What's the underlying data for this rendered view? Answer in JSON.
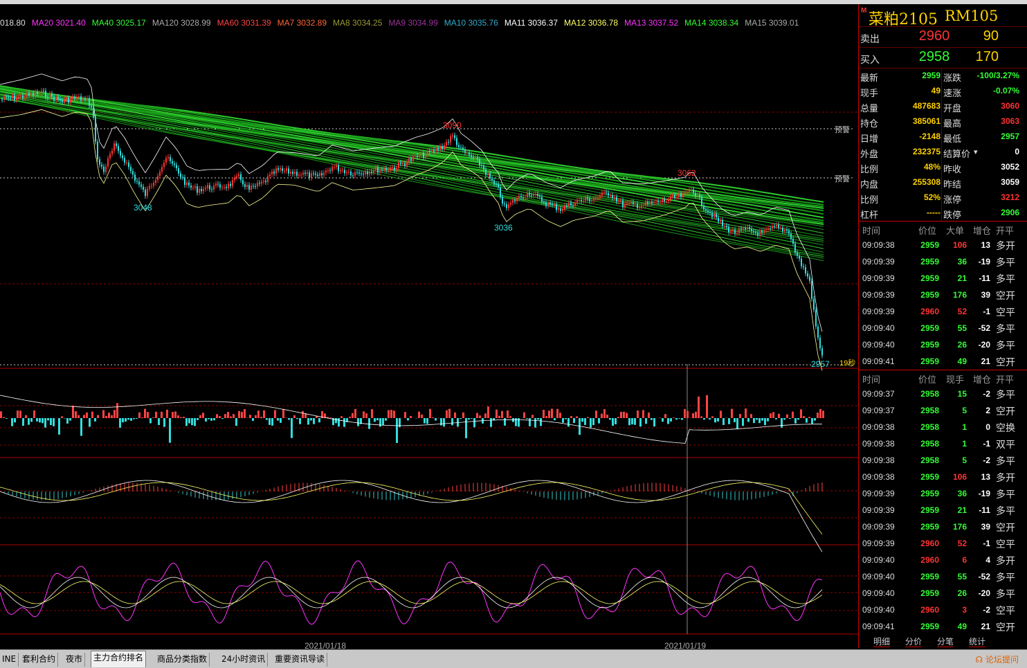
{
  "ma_legend": [
    {
      "text": "018.80",
      "color": "#dddddd"
    },
    {
      "text": "MA20 3021.40",
      "color": "#ff33ff"
    },
    {
      "text": "MA40 3025.17",
      "color": "#33ff33"
    },
    {
      "text": "MA120 3028.99",
      "color": "#aaaaaa"
    },
    {
      "text": "MA60 3031.39",
      "color": "#ff4444"
    },
    {
      "text": "MA7 3032.89",
      "color": "#ff6633"
    },
    {
      "text": "MA8 3034.25",
      "color": "#999933"
    },
    {
      "text": "MA9 3034.99",
      "color": "#993399"
    },
    {
      "text": "MA10 3035.76",
      "color": "#33aacc"
    },
    {
      "text": "MA11 3036.37",
      "color": "#ffffff"
    },
    {
      "text": "MA12 3036.78",
      "color": "#ffff66"
    },
    {
      "text": "MA13 3037.52",
      "color": "#ff33ff"
    },
    {
      "text": "MA14 3038.34",
      "color": "#33ff33"
    },
    {
      "text": "MA15 3039.01",
      "color": "#aaaaaa"
    }
  ],
  "chart": {
    "labels": {
      "high1": "3090",
      "low1": "3048",
      "low2": "3036",
      "high2": "3062",
      "last": "2957",
      "countdown": "19秒",
      "warn1": "预警",
      "warn2": "预警"
    },
    "dates": [
      "2021/01/18",
      "2021/01/19"
    ],
    "colors": {
      "up": "#ff3333",
      "down": "#33dddd",
      "ma_band": "#22bb22",
      "boll": "#ffffff",
      "grid": "#8b0000"
    }
  },
  "symbol": {
    "marker": "M",
    "name": "菜粕2105",
    "code": "RM105"
  },
  "bid_ask": [
    {
      "label": "卖出",
      "price": "2960",
      "volume": "90",
      "price_color": "#ff3333"
    },
    {
      "label": "买入",
      "price": "2958",
      "volume": "170",
      "price_color": "#33ff33"
    }
  ],
  "quote": [
    {
      "l1": "最新",
      "v1": "2959",
      "c1": "#33ff33",
      "l2": "涨跌",
      "v2": "-100/3.27%",
      "c2": "#33ff33"
    },
    {
      "l1": "现手",
      "v1": "49",
      "c1": "#ffd200",
      "l2": "速涨",
      "v2": "-0.07%",
      "c2": "#33ff33"
    },
    {
      "l1": "总量",
      "v1": "487683",
      "c1": "#ffd200",
      "l2": "开盘",
      "v2": "3060",
      "c2": "#ff3333"
    },
    {
      "l1": "持仓",
      "v1": "385061",
      "c1": "#ffd200",
      "l2": "最高",
      "v2": "3063",
      "c2": "#ff3333"
    },
    {
      "l1": "日增",
      "v1": "-2148",
      "c1": "#ffd200",
      "l2": "最低",
      "v2": "2957",
      "c2": "#33ff33"
    },
    {
      "l1": "外盘",
      "v1": "232375",
      "c1": "#ffd200",
      "l2": "结算价",
      "v2": "0",
      "c2": "#ffffff"
    },
    {
      "l1": "比例",
      "v1": "48%",
      "c1": "#ffd200",
      "l2": "昨收",
      "v2": "3052",
      "c2": "#ffffff"
    },
    {
      "l1": "内盘",
      "v1": "255308",
      "c1": "#ffd200",
      "l2": "昨结",
      "v2": "3059",
      "c2": "#ffffff"
    },
    {
      "l1": "比例",
      "v1": "52%",
      "c1": "#ffd200",
      "l2": "涨停",
      "v2": "3212",
      "c2": "#ff3333"
    },
    {
      "l1": "杠杆",
      "v1": "-----",
      "c1": "#ffd200",
      "l2": "跌停",
      "v2": "2906",
      "c2": "#33ff33"
    }
  ],
  "tick_header": {
    "time": "时间",
    "price": "价位",
    "big": "大单",
    "oi": "增仓",
    "type": "开平"
  },
  "ticks1": [
    {
      "time": "09:09:38",
      "price": "2959",
      "pc": "#33ff33",
      "big": "106",
      "bc": "#ff3333",
      "oi": "13",
      "type": "多开"
    },
    {
      "time": "09:09:39",
      "price": "2959",
      "pc": "#33ff33",
      "big": "36",
      "bc": "#33ff33",
      "oi": "-19",
      "type": "多平"
    },
    {
      "time": "09:09:39",
      "price": "2959",
      "pc": "#33ff33",
      "big": "21",
      "bc": "#33ff33",
      "oi": "-11",
      "type": "多平"
    },
    {
      "time": "09:09:39",
      "price": "2959",
      "pc": "#33ff33",
      "big": "176",
      "bc": "#33ff33",
      "oi": "39",
      "type": "空开"
    },
    {
      "time": "09:09:39",
      "price": "2960",
      "pc": "#ff3333",
      "big": "52",
      "bc": "#ff3333",
      "oi": "-1",
      "type": "空平"
    },
    {
      "time": "09:09:40",
      "price": "2959",
      "pc": "#33ff33",
      "big": "55",
      "bc": "#33ff33",
      "oi": "-52",
      "type": "多平"
    },
    {
      "time": "09:09:40",
      "price": "2959",
      "pc": "#33ff33",
      "big": "26",
      "bc": "#33ff33",
      "oi": "-20",
      "type": "多平"
    },
    {
      "time": "09:09:41",
      "price": "2959",
      "pc": "#33ff33",
      "big": "49",
      "bc": "#33ff33",
      "oi": "21",
      "type": "空开"
    }
  ],
  "tick_header2": {
    "time": "时间",
    "price": "价位",
    "big": "现手",
    "oi": "增仓",
    "type": "开平"
  },
  "ticks2": [
    {
      "time": "09:09:37",
      "price": "2958",
      "pc": "#33ff33",
      "big": "15",
      "bc": "#33ff33",
      "oi": "-2",
      "type": "多平"
    },
    {
      "time": "09:09:37",
      "price": "2958",
      "pc": "#33ff33",
      "big": "5",
      "bc": "#33ff33",
      "oi": "2",
      "type": "空开"
    },
    {
      "time": "09:09:38",
      "price": "2958",
      "pc": "#33ff33",
      "big": "1",
      "bc": "#33ff33",
      "oi": "0",
      "type": "空换"
    },
    {
      "time": "09:09:38",
      "price": "2958",
      "pc": "#33ff33",
      "big": "1",
      "bc": "#33ff33",
      "oi": "-1",
      "type": "双平"
    },
    {
      "time": "09:09:38",
      "price": "2958",
      "pc": "#33ff33",
      "big": "5",
      "bc": "#33ff33",
      "oi": "-2",
      "type": "多平"
    },
    {
      "time": "09:09:38",
      "price": "2959",
      "pc": "#33ff33",
      "big": "106",
      "bc": "#ff3333",
      "oi": "13",
      "type": "多开"
    },
    {
      "time": "09:09:39",
      "price": "2959",
      "pc": "#33ff33",
      "big": "36",
      "bc": "#33ff33",
      "oi": "-19",
      "type": "多平"
    },
    {
      "time": "09:09:39",
      "price": "2959",
      "pc": "#33ff33",
      "big": "21",
      "bc": "#33ff33",
      "oi": "-11",
      "type": "多平"
    },
    {
      "time": "09:09:39",
      "price": "2959",
      "pc": "#33ff33",
      "big": "176",
      "bc": "#33ff33",
      "oi": "39",
      "type": "空开"
    },
    {
      "time": "09:09:39",
      "price": "2960",
      "pc": "#ff3333",
      "big": "52",
      "bc": "#ff3333",
      "oi": "-1",
      "type": "空平"
    },
    {
      "time": "09:09:40",
      "price": "2960",
      "pc": "#ff3333",
      "big": "6",
      "bc": "#ff3333",
      "oi": "4",
      "type": "多开"
    },
    {
      "time": "09:09:40",
      "price": "2959",
      "pc": "#33ff33",
      "big": "55",
      "bc": "#33ff33",
      "oi": "-52",
      "type": "多平"
    },
    {
      "time": "09:09:40",
      "price": "2959",
      "pc": "#33ff33",
      "big": "26",
      "bc": "#33ff33",
      "oi": "-20",
      "type": "多平"
    },
    {
      "time": "09:09:40",
      "price": "2960",
      "pc": "#ff3333",
      "big": "3",
      "bc": "#ff3333",
      "oi": "-2",
      "type": "空平"
    },
    {
      "time": "09:09:41",
      "price": "2959",
      "pc": "#33ff33",
      "big": "49",
      "bc": "#33ff33",
      "oi": "21",
      "type": "空开"
    }
  ],
  "right_tabs": [
    "明细",
    "分价",
    "分笔",
    "统计"
  ],
  "bottom_tabs": [
    "INE",
    "套利合约",
    "夜市",
    "主力合约排名",
    "商品分类指数",
    "24小时资讯",
    "重要资讯导读"
  ],
  "active_bottom_tab": "主力合约排名",
  "forum_link": "论坛提问"
}
